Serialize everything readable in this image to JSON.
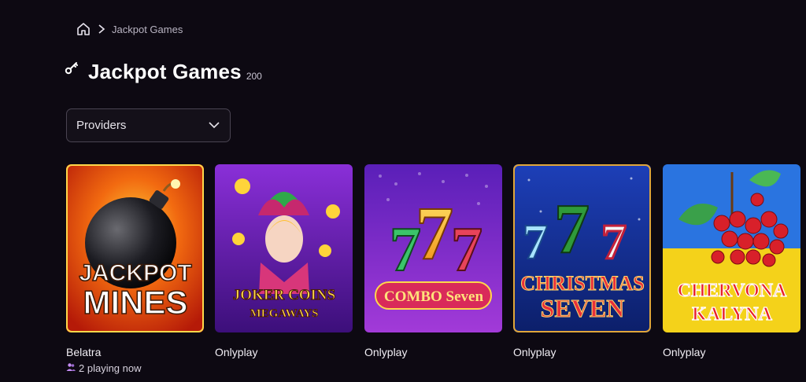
{
  "breadcrumb": {
    "current": "Jackpot Games"
  },
  "header": {
    "title": "Jackpot Games",
    "count": "200"
  },
  "filters": {
    "providers_label": "Providers"
  },
  "games": [
    {
      "title_line1": "JACKPOT",
      "title_line2": "MINES",
      "provider": "Belatra",
      "playing": "2 playing now"
    },
    {
      "title_line1": "JOKER COINS",
      "title_line2": "MEGAWAYS",
      "provider": "Onlyplay"
    },
    {
      "title_line1": "COMBO Seven",
      "provider": "Onlyplay"
    },
    {
      "title_line1": "CHRISTMAS",
      "title_line2": "SEVEN",
      "provider": "Onlyplay"
    },
    {
      "title_line1": "CHERVONA",
      "title_line2": "KALYNA",
      "provider": "Onlyplay"
    }
  ],
  "colors": {
    "background": "#0d0912",
    "accent_yellow": "#f5c400",
    "accent_purple": "#7a2fd0"
  }
}
